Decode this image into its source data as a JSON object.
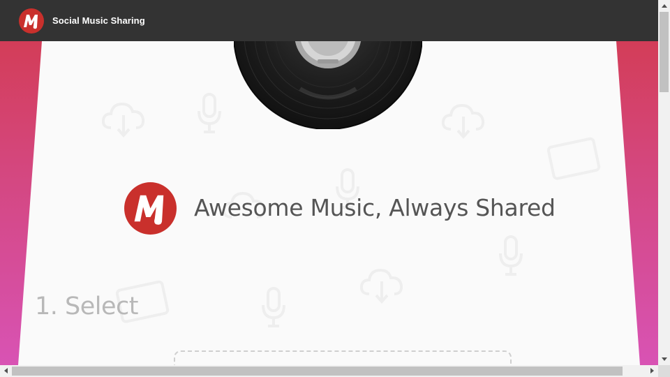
{
  "header": {
    "app_title": "Social Music Sharing",
    "logo_icon": "music-m-logo-icon"
  },
  "hero": {
    "tagline": "Awesome Music, Always Shared",
    "logo_icon": "music-m-logo-icon",
    "vinyl_icon": "vinyl-record-icon"
  },
  "step": {
    "title": "1. Select"
  },
  "colors": {
    "topbar": "#333333",
    "brand_red": "#c9302c",
    "gradient_top": "#d33d58",
    "gradient_bottom": "#d853b4",
    "card": "#fafafa",
    "tagline_text": "#555555",
    "step_text": "#b8b8b8"
  },
  "background_icons": [
    "cloud-download-icon",
    "microphone-icon",
    "tablet-icon"
  ]
}
